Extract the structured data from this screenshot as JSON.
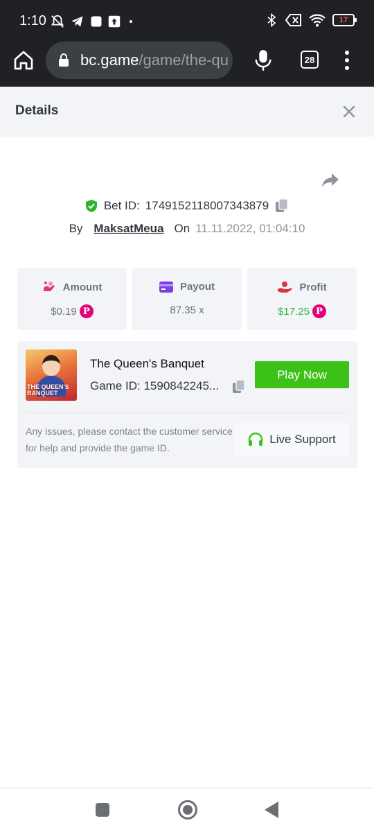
{
  "status_bar": {
    "time": "1:10",
    "battery_level": "17",
    "icons_left": [
      "mute-icon",
      "telegram-icon",
      "square-icon",
      "upload-icon",
      "dot-icon"
    ],
    "icons_right": [
      "bluetooth-icon",
      "data-off-icon",
      "wifi-icon",
      "battery-icon"
    ]
  },
  "browser": {
    "url_domain": "bc.game",
    "url_path": "/game/the-qu",
    "tab_count": "28"
  },
  "details": {
    "title": "Details",
    "bet_id_label": "Bet ID:",
    "bet_id": "1749152118007343879",
    "by_label": "By",
    "username": "MaksatMeua",
    "on_label": "On",
    "datetime": "11.11.2022, 01:04:10"
  },
  "stats": {
    "amount_label": "Amount",
    "amount_value": "$0.19",
    "payout_label": "Payout",
    "payout_value": "87.35 x",
    "profit_label": "Profit",
    "profit_value": "$17.25",
    "coin_symbol": "P",
    "colors": {
      "amount_icon": "#e6337a",
      "payout_icon": "#7b3fe4",
      "profit_icon": "#e0343c",
      "profit_text": "#2ab52d",
      "coin": "#e6007a"
    }
  },
  "game": {
    "name": "The Queen's Banquet",
    "thumb_title": "THE QUEEN'S BANQUET",
    "game_id": "Game ID: 1590842245...",
    "play_label": "Play Now",
    "issues_text": "Any issues, please contact the customer service for help and provide the game ID.",
    "support_label": "Live Support",
    "colors": {
      "play_button": "#3bc117",
      "support_icon": "#3bc117"
    }
  }
}
